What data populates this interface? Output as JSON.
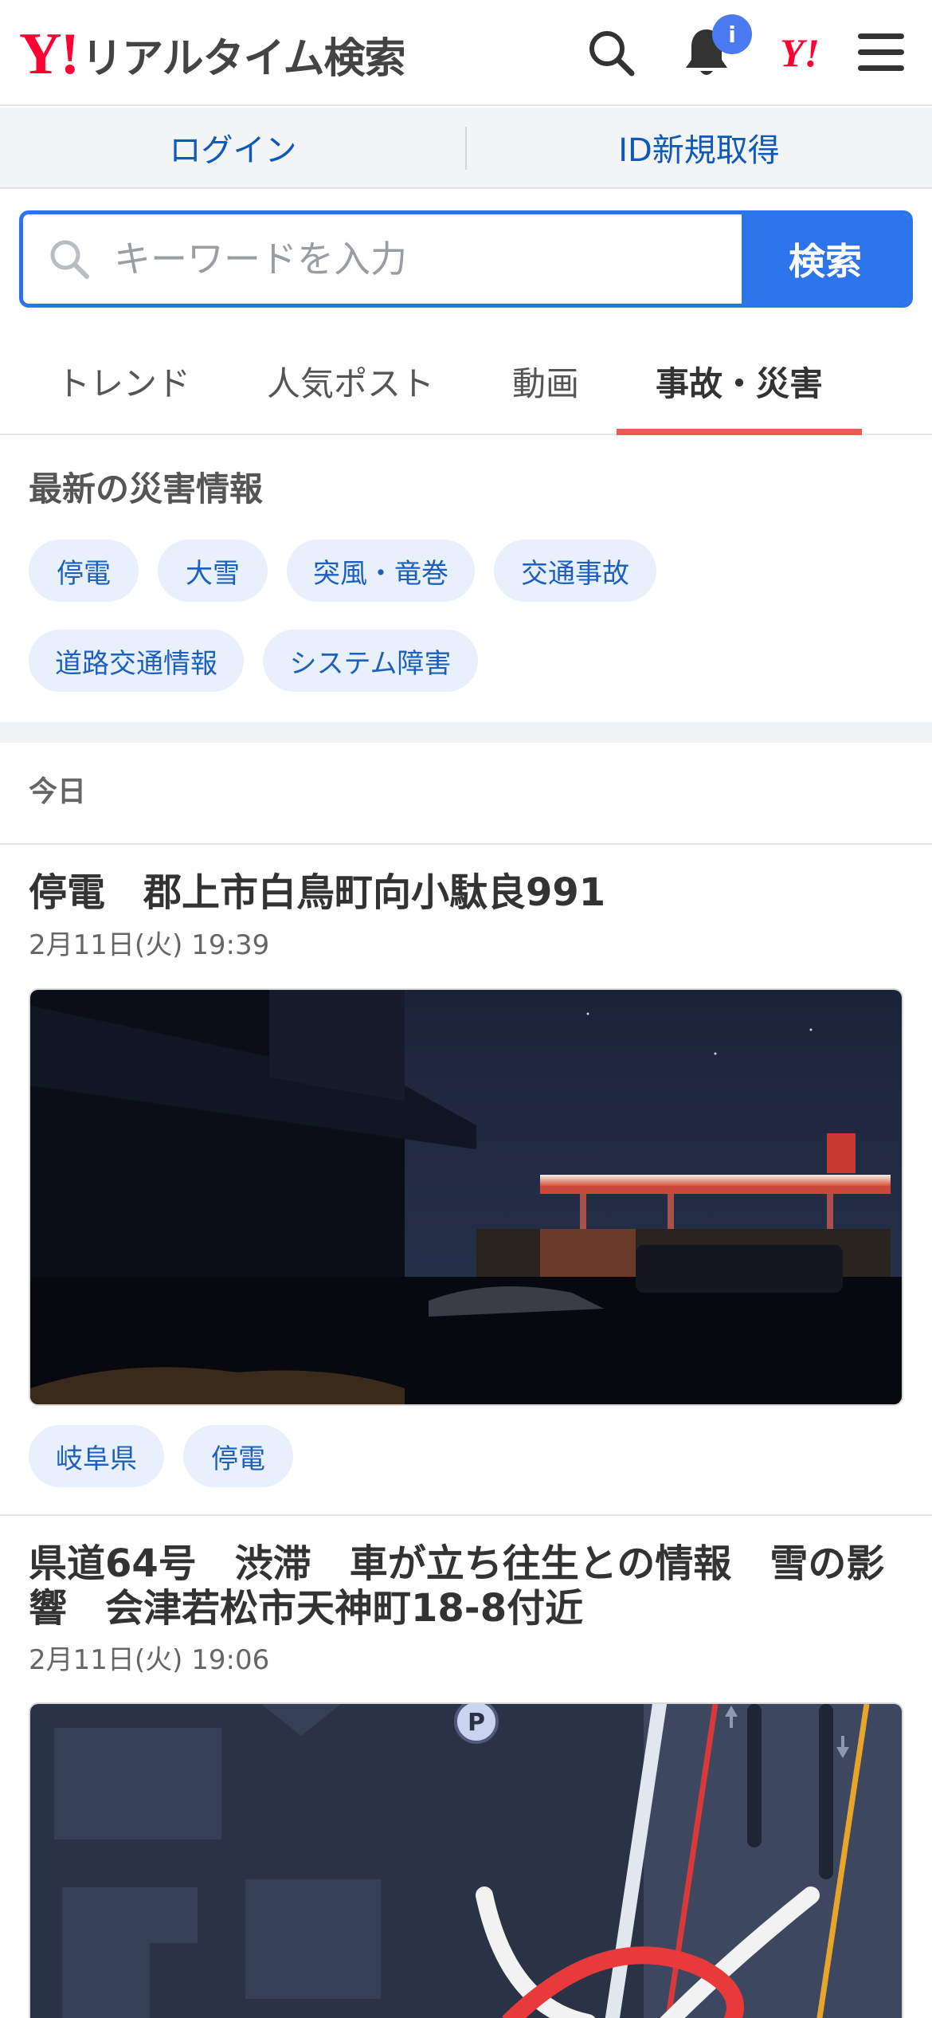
{
  "header": {
    "logo_mark": "Y!",
    "logo_text": "リアルタイム検索",
    "notification_badge": "i",
    "yahoo_mark": "Y!"
  },
  "account": {
    "login": "ログイン",
    "signup": "ID新規取得"
  },
  "search": {
    "placeholder": "キーワードを入力",
    "button": "検索"
  },
  "tabs": [
    {
      "label": "トレンド",
      "active": false
    },
    {
      "label": "人気ポスト",
      "active": false
    },
    {
      "label": "動画",
      "active": false
    },
    {
      "label": "事故・災害",
      "active": true
    }
  ],
  "disaster": {
    "title": "最新の災害情報",
    "chips": [
      "停電",
      "大雪",
      "突風・竜巻",
      "交通事故",
      "道路交通情報",
      "システム障害"
    ]
  },
  "feed": {
    "section_label": "今日",
    "items": [
      {
        "title": "停電　郡上市白鳥町向小駄良991",
        "date": "2月11日(火) 19:39",
        "tags": [
          "岐阜県",
          "停電"
        ]
      },
      {
        "title": "県道64号　渋滞　車が立ち往生との情報　雪の影響　会津若松市天神町18-8付近",
        "date": "2月11日(火) 19:06",
        "map_marker": "P"
      }
    ]
  },
  "colors": {
    "brand_red": "#ff0033",
    "link_blue": "#0f5ab8",
    "search_blue": "#2d73ea",
    "tab_underline": "#e85c54",
    "chip_bg": "#e8f0fc"
  }
}
